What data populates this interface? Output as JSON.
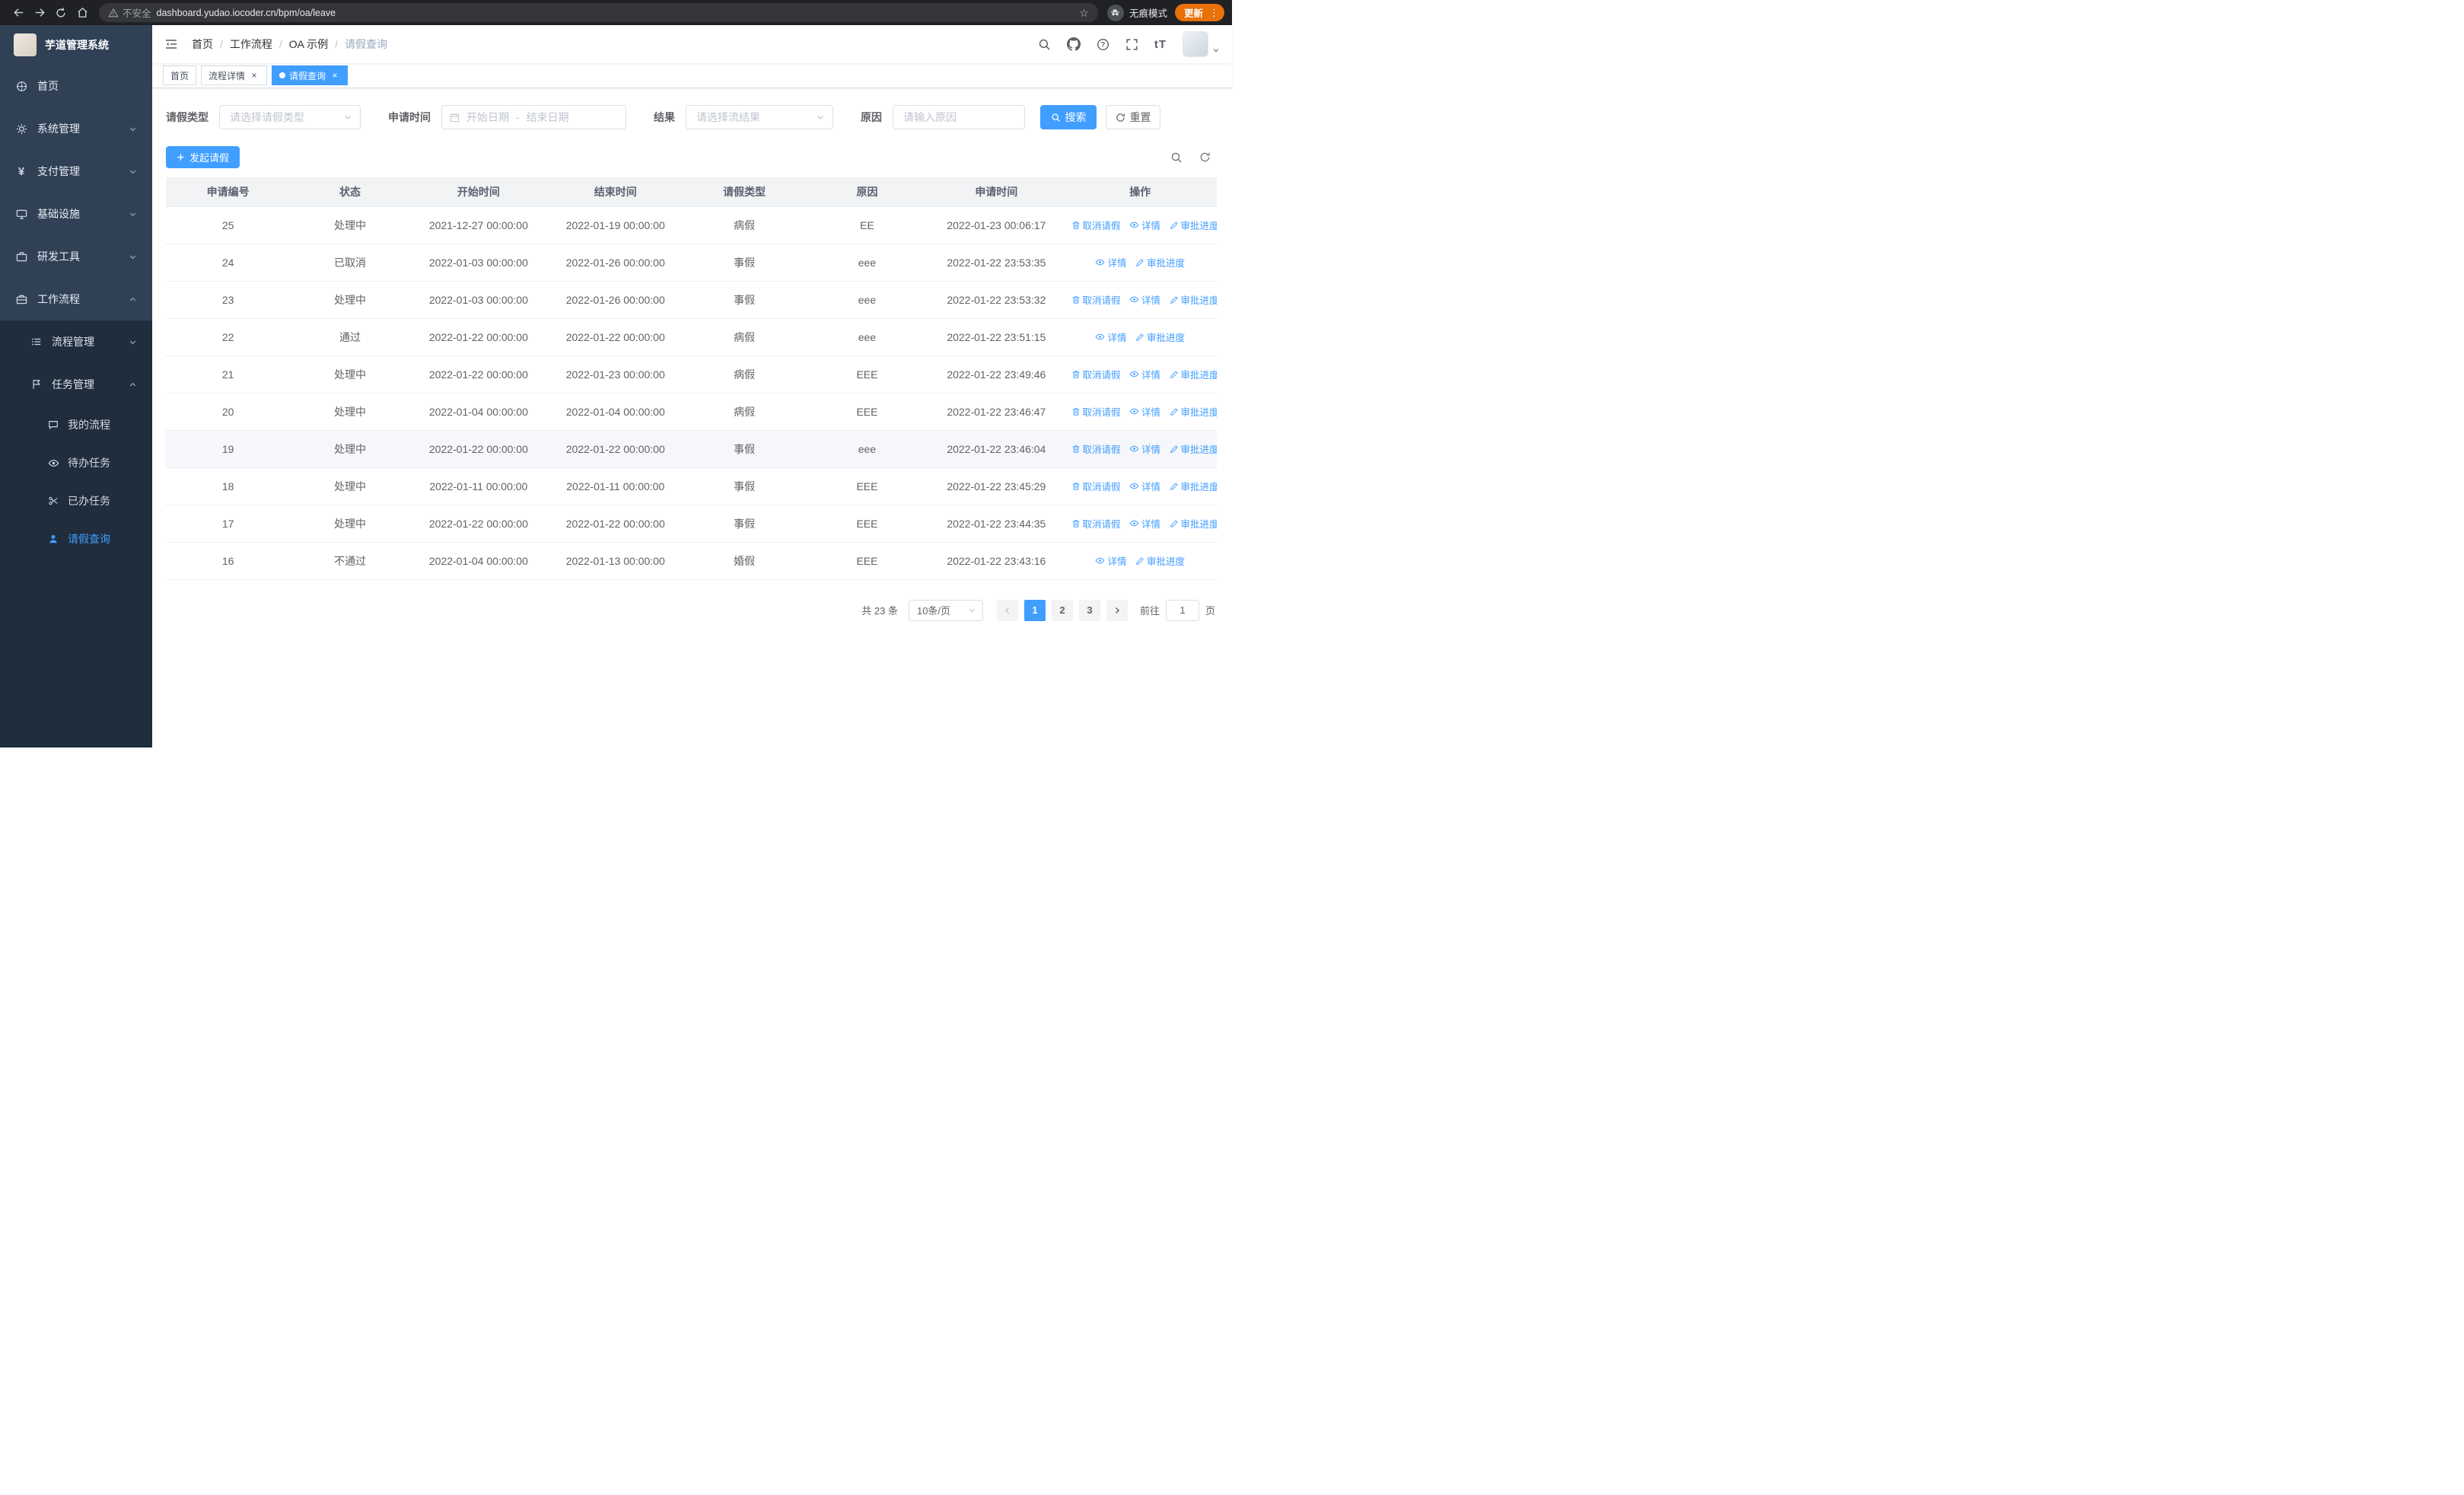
{
  "browser": {
    "security_label": "不安全",
    "url": "dashboard.yudao.iocoder.cn/bpm/oa/leave",
    "incognito_label": "无痕模式",
    "update_label": "更新"
  },
  "icons": {
    "close": "×",
    "star": "☆",
    "kebab": "⋮",
    "payment_yen": "¥",
    "font_size": "tT",
    "breadcrumb_separator": "/"
  },
  "sidebar": {
    "app_title": "芋道管理系统",
    "items": {
      "home": "首页",
      "system": "系统管理",
      "payment": "支付管理",
      "infra": "基础设施",
      "devtools": "研发工具",
      "workflow": "工作流程",
      "process_mgmt": "流程管理",
      "task_mgmt": "任务管理",
      "my_process": "我的流程",
      "todo_tasks": "待办任务",
      "done_tasks": "已办任务",
      "leave_query": "请假查询"
    }
  },
  "header": {
    "breadcrumb": [
      "首页",
      "工作流程",
      "OA 示例",
      "请假查询"
    ]
  },
  "tabs": [
    {
      "label": "首页"
    },
    {
      "label": "流程详情"
    },
    {
      "label": "请假查询"
    }
  ],
  "filters": {
    "leave_type_label": "请假类型",
    "leave_type_placeholder": "请选择请假类型",
    "apply_time_label": "申请时间",
    "date_start_placeholder": "开始日期",
    "date_separator": "-",
    "date_end_placeholder": "结束日期",
    "result_label": "结果",
    "result_placeholder": "请选择流结果",
    "reason_label": "原因",
    "reason_placeholder": "请输入原因",
    "search_label": "搜索",
    "reset_label": "重置"
  },
  "toolbar": {
    "create_label": "发起请假"
  },
  "table": {
    "headers": [
      "申请编号",
      "状态",
      "开始时间",
      "结束时间",
      "请假类型",
      "原因",
      "申请时间",
      "操作"
    ],
    "actions": {
      "cancel": "取消请假",
      "detail": "详情",
      "progress": "审批进度"
    },
    "rows": [
      {
        "id": "25",
        "status": "处理中",
        "start": "2021-12-27 00:00:00",
        "end": "2022-01-19 00:00:00",
        "type": "病假",
        "reason": "EE",
        "applied": "2022-01-23 00:06:17",
        "cancellable": true,
        "highlight": false
      },
      {
        "id": "24",
        "status": "已取消",
        "start": "2022-01-03 00:00:00",
        "end": "2022-01-26 00:00:00",
        "type": "事假",
        "reason": "eee",
        "applied": "2022-01-22 23:53:35",
        "cancellable": false,
        "highlight": false
      },
      {
        "id": "23",
        "status": "处理中",
        "start": "2022-01-03 00:00:00",
        "end": "2022-01-26 00:00:00",
        "type": "事假",
        "reason": "eee",
        "applied": "2022-01-22 23:53:32",
        "cancellable": true,
        "highlight": false
      },
      {
        "id": "22",
        "status": "通过",
        "start": "2022-01-22 00:00:00",
        "end": "2022-01-22 00:00:00",
        "type": "病假",
        "reason": "eee",
        "applied": "2022-01-22 23:51:15",
        "cancellable": false,
        "highlight": false
      },
      {
        "id": "21",
        "status": "处理中",
        "start": "2022-01-22 00:00:00",
        "end": "2022-01-23 00:00:00",
        "type": "病假",
        "reason": "EEE",
        "applied": "2022-01-22 23:49:46",
        "cancellable": true,
        "highlight": false
      },
      {
        "id": "20",
        "status": "处理中",
        "start": "2022-01-04 00:00:00",
        "end": "2022-01-04 00:00:00",
        "type": "病假",
        "reason": "EEE",
        "applied": "2022-01-22 23:46:47",
        "cancellable": true,
        "highlight": false
      },
      {
        "id": "19",
        "status": "处理中",
        "start": "2022-01-22 00:00:00",
        "end": "2022-01-22 00:00:00",
        "type": "事假",
        "reason": "eee",
        "applied": "2022-01-22 23:46:04",
        "cancellable": true,
        "highlight": true
      },
      {
        "id": "18",
        "status": "处理中",
        "start": "2022-01-11 00:00:00",
        "end": "2022-01-11 00:00:00",
        "type": "事假",
        "reason": "EEE",
        "applied": "2022-01-22 23:45:29",
        "cancellable": true,
        "highlight": false
      },
      {
        "id": "17",
        "status": "处理中",
        "start": "2022-01-22 00:00:00",
        "end": "2022-01-22 00:00:00",
        "type": "事假",
        "reason": "EEE",
        "applied": "2022-01-22 23:44:35",
        "cancellable": true,
        "highlight": false
      },
      {
        "id": "16",
        "status": "不通过",
        "start": "2022-01-04 00:00:00",
        "end": "2022-01-13 00:00:00",
        "type": "婚假",
        "reason": "EEE",
        "applied": "2022-01-22 23:43:16",
        "cancellable": false,
        "highlight": false
      }
    ]
  },
  "pagination": {
    "total_label": "共 23 条",
    "page_size_label": "10条/页",
    "pages": [
      "1",
      "2",
      "3"
    ],
    "active_page": "1",
    "goto_label": "前往",
    "goto_value": "1",
    "page_suffix": "页"
  },
  "colors": {
    "accent": "#409eff",
    "sidebar_bg": "#304156",
    "sidebar_submenu_bg": "#1f2d3d",
    "update_chip_bg": "#e8710a"
  }
}
